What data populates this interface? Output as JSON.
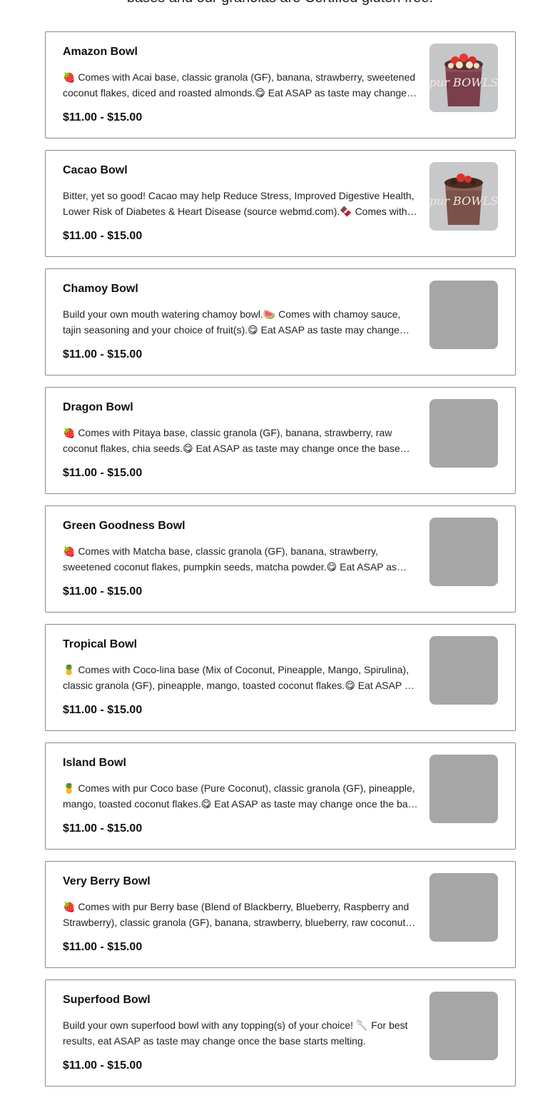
{
  "intro_text": "bases and our granolas are Certified gluten free.",
  "items": [
    {
      "name": "Amazon Bowl",
      "description": "🍓 Comes with Acai base, classic granola (GF), banana, strawberry, sweetened coconut flakes, diced and roasted almonds.😋 Eat ASAP as taste may change once the base starts melting.",
      "price": "$11.00 - $15.00",
      "photo": "acai-bowl-photo",
      "logo": "pur BOWLS"
    },
    {
      "name": "Cacao Bowl",
      "description": "Bitter, yet so good! Cacao may help Reduce Stress, Improved Digestive Health, Lower Risk of Diabetes & Heart Disease (source webmd.com).🍫 Comes with cacao base, classic granola (GF), banana, strawberry.",
      "price": "$11.00 - $15.00",
      "photo": "cacao-bowl-photo",
      "logo": "pur BOWLS"
    },
    {
      "name": "Chamoy Bowl",
      "description": "Build your own mouth watering chamoy bowl.🍉 Comes with chamoy sauce, tajin seasoning and your choice of fruit(s).😋 Eat ASAP as taste may change once the base starts melting.",
      "price": "$11.00 - $15.00",
      "photo": "placeholder-photo"
    },
    {
      "name": "Dragon Bowl",
      "description": "🍓 Comes with Pitaya base, classic granola (GF), banana, strawberry, raw coconut flakes, chia seeds.😋 Eat ASAP as taste may change once the base starts melting.",
      "price": "$11.00 - $15.00",
      "photo": "placeholder-photo"
    },
    {
      "name": "Green Goodness Bowl",
      "description": "🍓 Comes with Matcha base, classic granola (GF), banana, strawberry, sweetened coconut flakes, pumpkin seeds, matcha powder.😋 Eat ASAP as taste may change once the base starts melting.",
      "price": "$11.00 - $15.00",
      "photo": "placeholder-photo"
    },
    {
      "name": "Tropical Bowl",
      "description": "🍍 Comes with Coco-lina base (Mix of Coconut, Pineapple, Mango, Spirulina), classic granola (GF), pineapple, mango, toasted coconut flakes.😋 Eat ASAP as taste may change once the base starts melting.",
      "price": "$11.00 - $15.00",
      "photo": "placeholder-photo"
    },
    {
      "name": "Island Bowl",
      "description": "🍍 Comes with pur Coco base (Pure Coconut), classic granola (GF), pineapple, mango, toasted coconut flakes.😋 Eat ASAP as taste may change once the base starts melting.",
      "price": "$11.00 - $15.00",
      "photo": "placeholder-photo"
    },
    {
      "name": "Very Berry Bowl",
      "description": "🍓 Comes with pur Berry base (Blend of Blackberry, Blueberry, Raspberry and Strawberry), classic granola (GF), banana, strawberry, blueberry, raw coconut flakes.",
      "price": "$11.00 - $15.00",
      "photo": "placeholder-photo"
    },
    {
      "name": "Superfood Bowl",
      "description": "Build your own superfood bowl with any topping(s) of your choice! 🥄 For best results, eat ASAP as taste may change once the base starts melting.",
      "price": "$11.00 - $15.00",
      "photo": "placeholder-photo"
    }
  ],
  "colors": {
    "card_border": "#8a8a8a",
    "placeholder": "#a6a6a6",
    "acai": "#7a3f4a",
    "cacao": "#7b5248",
    "strawberry": "#e0322c"
  }
}
